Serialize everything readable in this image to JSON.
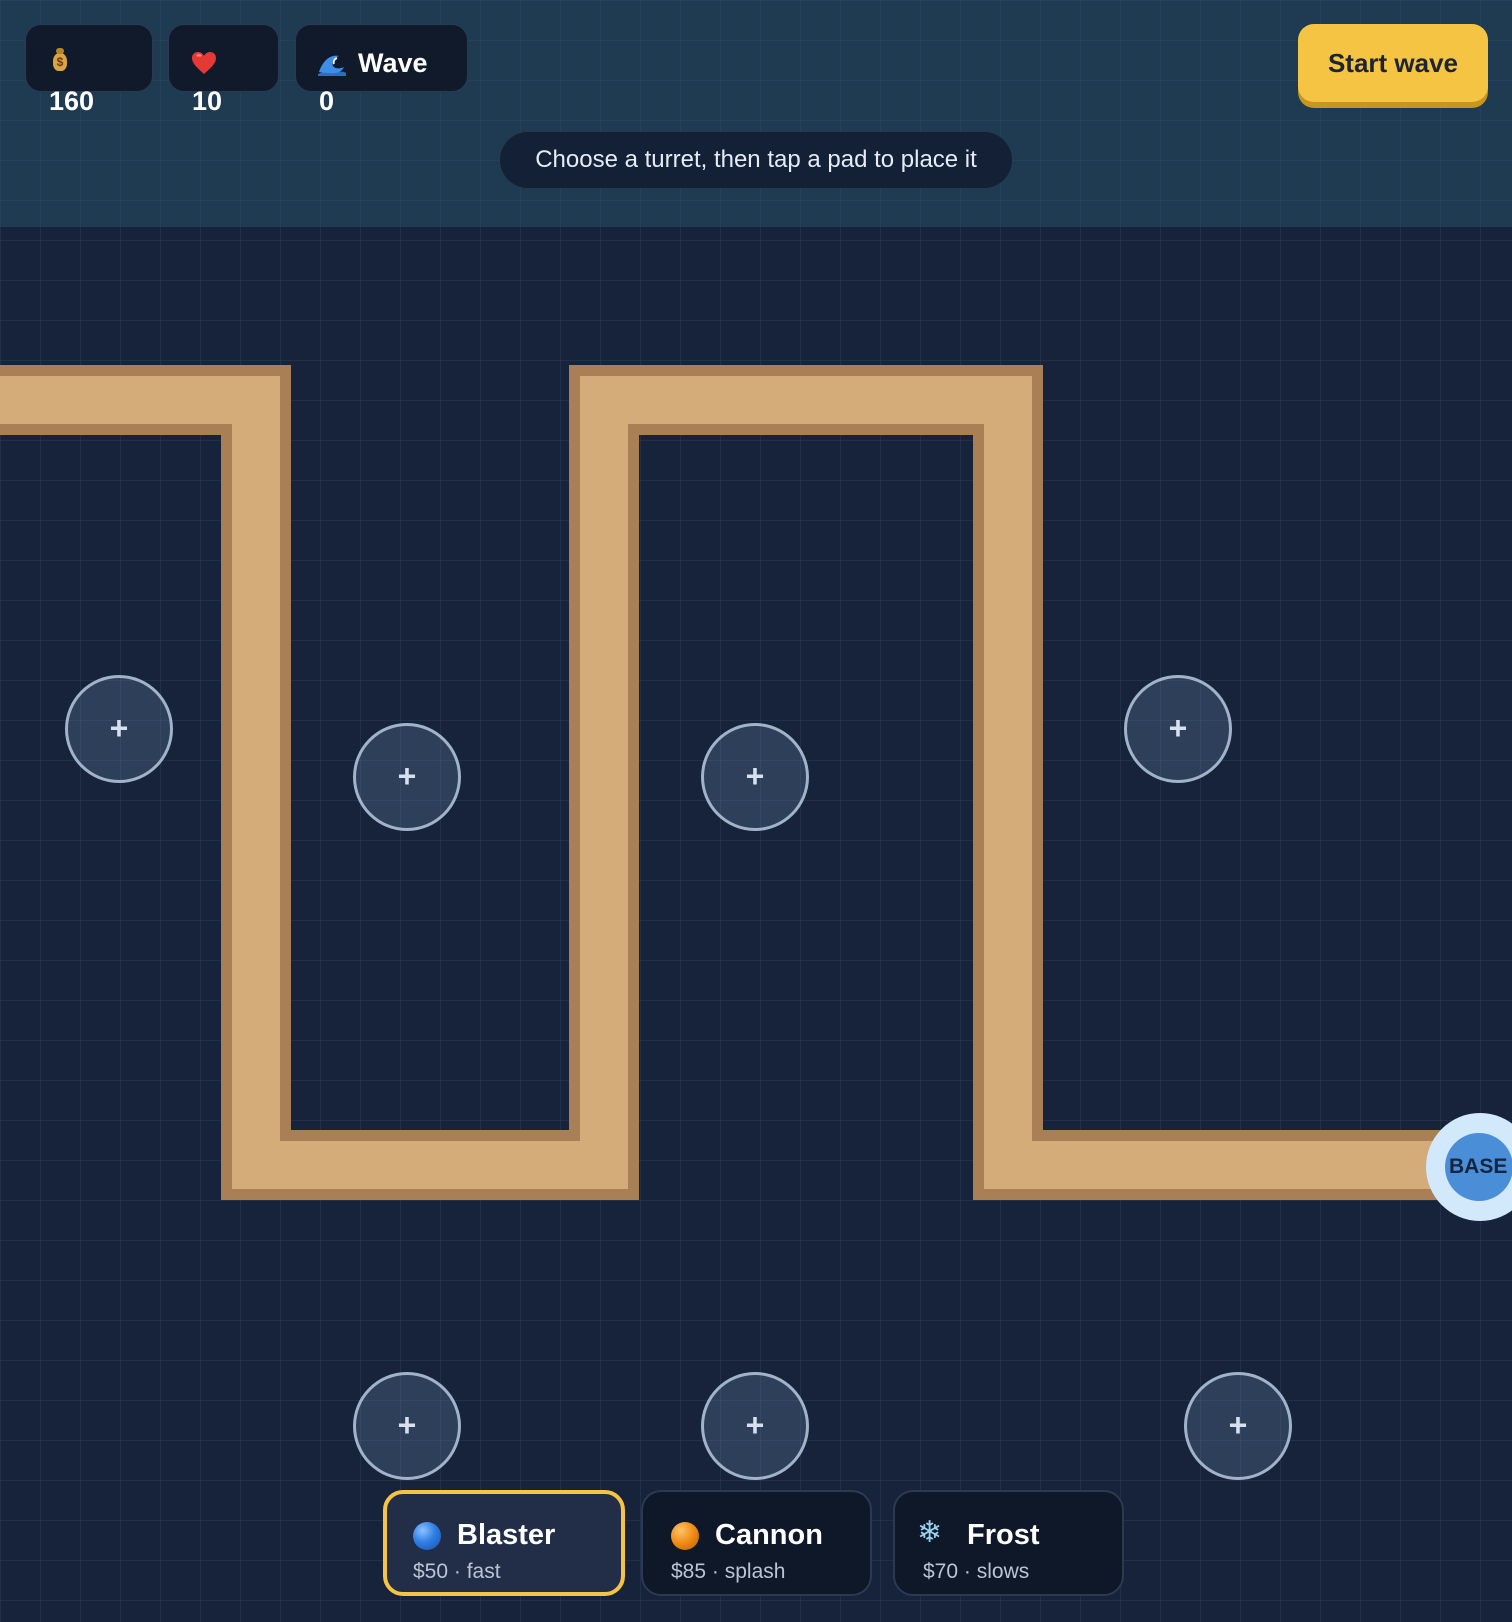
{
  "hud": {
    "money": {
      "icon": "money-bag-icon",
      "value": "160"
    },
    "lives": {
      "icon": "heart-icon",
      "value": "10"
    },
    "wave": {
      "icon": "wave-icon",
      "label": "Wave",
      "value": "0"
    }
  },
  "start_button": {
    "label": "Start wave"
  },
  "hint": "Choose a turret, then tap a pad to place it",
  "board": {
    "pads": [
      {
        "label": "+"
      },
      {
        "label": "+"
      },
      {
        "label": "+"
      },
      {
        "label": "+"
      },
      {
        "label": "+"
      },
      {
        "label": "+"
      },
      {
        "label": "+"
      }
    ],
    "base": {
      "label": "BASE"
    }
  },
  "turrets": [
    {
      "name": "Blaster",
      "price": "$50",
      "trait": "fast",
      "icon": "blue-orb-icon",
      "color": "#2f7fe6",
      "selected": true
    },
    {
      "name": "Cannon",
      "price": "$85",
      "trait": "splash",
      "icon": "orange-orb-icon",
      "color": "#f08a12",
      "selected": false
    },
    {
      "name": "Frost",
      "price": "$70",
      "trait": "slows",
      "icon": "snowflake-icon",
      "color": "#9ad3f2",
      "selected": false
    }
  ],
  "colors": {
    "accent": "#f6c443",
    "path": "#d4ac7a",
    "path_edge": "#a97f55",
    "background": "#16233a"
  }
}
